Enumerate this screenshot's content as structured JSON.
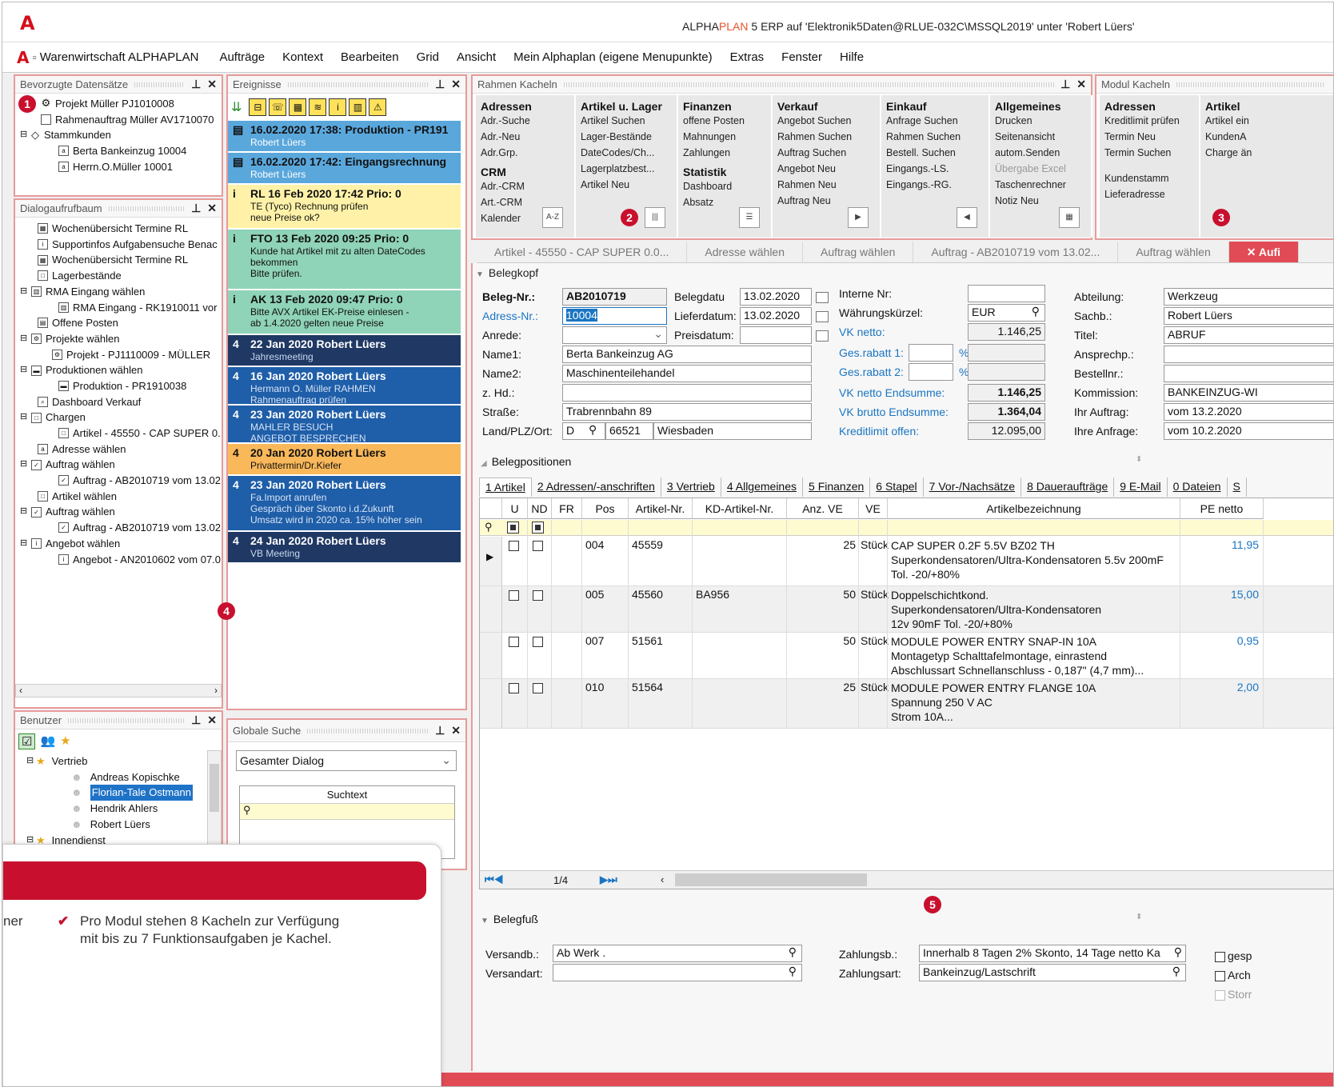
{
  "window": {
    "title_pre": "ALPHA",
    "title_plan": "PLAN",
    "title_post": " 5 ERP auf 'Elektronik5Daten@RLUE-032C\\MSSQL2019' unter 'Robert Lüers'"
  },
  "menu": {
    "app": "Warenwirtschaft ALPHAPLAN",
    "items": [
      "Aufträge",
      "Kontext",
      "Bearbeiten",
      "Grid",
      "Ansicht",
      "Mein Alphaplan (eigene Menupunkte)",
      "Extras",
      "Fenster",
      "Hilfe"
    ]
  },
  "fav": {
    "title": "Bevorzugte Datensätze",
    "items": [
      "Projekt Müller PJ1010008",
      "Rahmenauftrag Müller AV1710070",
      "Stammkunden",
      "Berta Bankeinzug 10004",
      "Herrn.O.Müller 10001"
    ]
  },
  "tree": {
    "title": "Dialogaufrufbaum",
    "items": [
      "Wochenübersicht Termine RL",
      "Supportinfos Aufgabensuche Benac",
      "Wochenübersicht Termine RL",
      "Lagerbestände",
      "RMA Eingang wählen",
      "RMA Eingang - RK1910011 vor",
      "Offene Posten",
      "Projekte wählen",
      "Projekt - PJ1110009 - MÜLLER",
      "Produktionen wählen",
      "Produktion - PR1910038",
      "Dashboard Verkauf",
      "Chargen",
      "Artikel - 45550 - CAP SUPER 0.",
      "Adresse wählen",
      "Auftrag wählen",
      "Auftrag - AB2010719 vom 13.02",
      "Artikel wählen",
      "Auftrag wählen",
      "Auftrag - AB2010719 vom 13.02",
      "Angebot wählen",
      "Angebot - AN2010602 vom 07.0"
    ]
  },
  "users": {
    "title": "Benutzer",
    "group1": "Vertrieb",
    "names": [
      "Andreas Kopischke",
      "Florian-Tale Ostmann",
      "Hendrik Ahlers",
      "Robert Lüers"
    ],
    "group2": "Innendienst"
  },
  "events": {
    "title": "Ereignisse",
    "toolbar_icons": [
      "⊟",
      "☏",
      "▦",
      "≋",
      "i",
      "▥",
      "⚠"
    ],
    "items": [
      {
        "icon": "▤",
        "head": "16.02.2020 17:38: Produktion - PR191",
        "lines": [
          "Robert Lüers"
        ]
      },
      {
        "icon": "▤",
        "head": "16.02.2020 17:42: Eingangsrechnung",
        "lines": [
          "Robert Lüers"
        ]
      },
      {
        "icon": "i",
        "head": "RL 16 Feb 2020 17:42 Prio: 0",
        "lines": [
          "TE (Tyco) Rechnung prüfen",
          "neue Preise ok?"
        ]
      },
      {
        "icon": "i",
        "head": "FTO 13 Feb 2020 09:25 Prio: 0",
        "lines": [
          "Kunde hat Artikel mit zu alten DateCodes",
          "bekommen",
          "Bitte prüfen."
        ]
      },
      {
        "icon": "i",
        "head": "AK 13 Feb 2020 09:47 Prio: 0",
        "lines": [
          "Bitte AVX Artikel EK-Preise einlesen -",
          "ab 1.4.2020 gelten neue Preise"
        ]
      },
      {
        "icon": "4",
        "head": "22 Jan 2020  Robert Lüers",
        "lines": [
          "Jahresmeeting"
        ]
      },
      {
        "icon": "4",
        "head": "16 Jan 2020  Robert Lüers",
        "lines": [
          "Hermann O. Müller RAHMEN",
          "Rahmenauftrag prüfen"
        ]
      },
      {
        "icon": "4",
        "head": "23 Jan 2020  Robert Lüers",
        "lines": [
          "MAHLER BESUCH",
          "ANGEBOT BESPRECHEN"
        ]
      },
      {
        "icon": "4",
        "head": "20 Jan 2020  Robert Lüers",
        "lines": [
          "Privattermin/Dr.Kiefer"
        ]
      },
      {
        "icon": "4",
        "head": "23 Jan 2020  Robert Lüers",
        "lines": [
          "Fa.Import anrufen",
          "Gespräch über Skonto i.d.Zukunft",
          "Umsatz wird in 2020 ca. 15% höher sein"
        ]
      },
      {
        "icon": "4",
        "head": "24 Jan 2020  Robert Lüers",
        "lines": [
          "VB Meeting"
        ]
      }
    ]
  },
  "search": {
    "title": "Globale Suche",
    "scope": "Gesamter Dialog",
    "col": "Suchtext"
  },
  "rahmen": {
    "title": "Rahmen Kacheln",
    "tiles": [
      {
        "head": "Adressen",
        "lines": [
          "Adr.-Suche",
          "Adr.-Neu",
          "Adr.Grp."
        ],
        "head2": "CRM",
        "lines2": [
          "Adr.-CRM",
          "Art.-CRM",
          "Kalender"
        ],
        "icon": "A-Z"
      },
      {
        "head": "Artikel u. Lager",
        "lines": [
          "Artikel Suchen",
          "Lager-Bestände",
          "DateCodes/Ch...",
          "Lagerplatzbest...",
          "Artikel Neu"
        ],
        "icon": "|||"
      },
      {
        "head": "Finanzen",
        "lines": [
          "offene Posten",
          "Mahnungen",
          "Zahlungen"
        ],
        "head2": "Statistik",
        "lines2": [
          "Dashboard",
          "Absatz"
        ],
        "icon": "☰"
      },
      {
        "head": "Verkauf",
        "lines": [
          "Angebot Suchen",
          "Rahmen Suchen",
          "Auftrag Suchen",
          "Angebot Neu",
          "Rahmen Neu",
          "Auftrag Neu"
        ],
        "icon": "▶"
      },
      {
        "head": "Einkauf",
        "lines": [
          "Anfrage Suchen",
          "Rahmen Suchen",
          "Bestell. Suchen",
          "Eingangs.-LS.",
          "Eingangs.-RG."
        ],
        "icon": "◀"
      },
      {
        "head": "Allgemeines",
        "lines": [
          "Drucken",
          "Seitenansicht",
          "autom.Senden",
          "Übergabe Excel",
          "Taschenrechner",
          "Notiz Neu"
        ],
        "icon": "▦"
      }
    ]
  },
  "modul": {
    "title": "Modul Kacheln",
    "tiles": [
      {
        "head": "Adressen",
        "lines": [
          "Kreditlimit prüfen",
          "Termin Neu",
          "Termin Suchen",
          "",
          "Kundenstamm",
          "Lieferadresse"
        ]
      },
      {
        "head": "Artikel",
        "lines": [
          "Artikel ein",
          "KundenA",
          "Charge än"
        ]
      }
    ]
  },
  "doctabs": [
    "Artikel - 45550 - CAP SUPER 0.0...",
    "Adresse wählen",
    "Auftrag wählen",
    "Auftrag - AB2010719 vom 13.02...",
    "Auftrag wählen",
    "✕ Aufi"
  ],
  "belegkopf": {
    "section": "Belegkopf",
    "belegnr_label": "Beleg-Nr.:",
    "belegnr": "AB2010719",
    "belegdatum_label": "Belegdatu",
    "belegdatum": "13.02.2020",
    "adressnr_label": "Adress-Nr.:",
    "adressnr": "10004",
    "lieferdatum_label": "Lieferdatum:",
    "lieferdatum": "13.02.2020",
    "anrede_label": "Anrede:",
    "preisdatum_label": "Preisdatum:",
    "name1_label": "Name1:",
    "name1": "Berta Bankeinzug AG",
    "name2_label": "Name2:",
    "name2": "Maschinenteilehandel",
    "zhd_label": "z. Hd.:",
    "strasse_label": "Straße:",
    "strasse": "Trabrennbahn 89",
    "land_label": "Land/PLZ/Ort:",
    "land": "D",
    "plz": "66521",
    "ort": "Wiesbaden",
    "interne_label": "Interne Nr:",
    "waehrung_label": "Währungskürzel:",
    "waehrung": "EUR",
    "vknetto_label": "VK netto:",
    "vknetto": "1.146,25",
    "gesrabatt1_label": "Ges.rabatt 1:",
    "gesrabatt2_label": "Ges.rabatt 2:",
    "pct": "%",
    "vknettoend_label": "VK netto Endsumme:",
    "vknettoend": "1.146,25",
    "vkbruttoend_label": "VK brutto Endsumme:",
    "vkbruttoend": "1.364,04",
    "kredit_label": "Kreditlimit offen:",
    "kredit": "12.095,00",
    "abteilung_label": "Abteilung:",
    "abteilung": "Werkzeug",
    "sachb_label": "Sachb.:",
    "sachb": "Robert Lüers",
    "titel_label": "Titel:",
    "titel": "ABRUF",
    "ansprech_label": "Ansprechp.:",
    "bestellnr_label": "Bestellnr.:",
    "kommission_label": "Kommission:",
    "kommission": "BANKEINZUG-WI",
    "ihrauftrag_label": "Ihr Auftrag:",
    "ihrauftrag": "vom 13.2.2020",
    "ihreanfrage_label": "Ihre Anfrage:",
    "ihreanfrage": "vom 10.2.2020"
  },
  "positions": {
    "section": "Belegpositionen",
    "tabs": [
      "1 Artikel",
      "2 Adressen/-anschriften",
      "3 Vertrieb",
      "4 Allgemeines",
      "5 Finanzen",
      "6 Stapel",
      "7 Vor-/Nachsätze",
      "8 Daueraufträge",
      "9 E-Mail",
      "0 Dateien",
      "S"
    ],
    "headers": [
      "U",
      "ND",
      "FR",
      "Pos",
      "Artikel-Nr.",
      "KD-Artikel-Nr.",
      "Anz. VE",
      "VE",
      "Artikelbezeichnung",
      "PE netto"
    ],
    "rows": [
      {
        "pos": "004",
        "art": "45559",
        "kd": "",
        "anz": "25",
        "ve": "Stück",
        "desc": [
          "CAP SUPER 0.2F 5.5V BZ02 TH",
          "Superkondensatoren/Ultra-Kondensatoren 5.5v 200mF",
          "Tol. -20/+80%"
        ],
        "pe": "11,95"
      },
      {
        "pos": "005",
        "art": "45560",
        "kd": "BA956",
        "anz": "50",
        "ve": "Stück",
        "desc": [
          "Doppelschichtkond.",
          "Superkondensatoren/Ultra-Kondensatoren",
          "12v 90mF Tol. -20/+80%"
        ],
        "pe": "15,00"
      },
      {
        "pos": "007",
        "art": "51561",
        "kd": "",
        "anz": "50",
        "ve": "Stück",
        "desc": [
          "MODULE POWER ENTRY SNAP-IN 10A",
          "Montagetyp Schalttafelmontage, einrastend",
          "Abschlussart Schnellanschluss - 0,187\" (4,7 mm)..."
        ],
        "pe": "0,95"
      },
      {
        "pos": "010",
        "art": "51564",
        "kd": "",
        "anz": "25",
        "ve": "Stück",
        "desc": [
          "MODULE POWER ENTRY FLANGE 10A",
          "Spannung 250 V AC",
          "Strom 10A..."
        ],
        "pe": "2,00"
      }
    ],
    "pager": "1/4"
  },
  "belegfuss": {
    "section": "Belegfuß",
    "versandb_label": "Versandb.:",
    "versandb": "Ab Werk .",
    "versandart_label": "Versandart:",
    "zahlungsb_label": "Zahlungsb.:",
    "zahlungsb": "Innerhalb 8 Tagen 2% Skonto, 14 Tage netto Ka",
    "zahlungsart_label": "Zahlungsart:",
    "zahlungsart": "Bankeinzug/Lastschrift",
    "checks": [
      "gesp",
      "Arch",
      "Storr"
    ]
  },
  "badges": [
    "1",
    "2",
    "3",
    "4",
    "5"
  ],
  "promo": {
    "left_fragment": "ner",
    "text1": "Pro Modul stehen 8 Kacheln zur Verfügung",
    "text2": "mit bis zu 7 Funktionsaufgaben je Kachel."
  },
  "colors": {
    "accent": "#c8102e",
    "blue_event": "#5aa7dc",
    "dark_event": "#1f3864",
    "mid_event": "#1f5ea8",
    "yellow_event": "#fff2a8",
    "green_event": "#8fd3b8",
    "orange_event": "#f9b85a"
  }
}
